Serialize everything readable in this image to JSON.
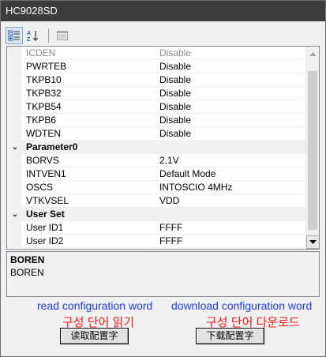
{
  "window": {
    "title": "HC9028SD"
  },
  "toolbar": {
    "buttons": [
      {
        "icon": "categorized-icon",
        "pressed": true
      },
      {
        "icon": "sort-alphabetical-icon",
        "pressed": false
      },
      {
        "icon": "property-pages-icon",
        "pressed": false
      }
    ]
  },
  "grid": {
    "rows": [
      {
        "kind": "prop",
        "name": "ICDEN",
        "value": "Disable",
        "muted": true
      },
      {
        "kind": "prop",
        "name": "PWRTEB",
        "value": "Disable"
      },
      {
        "kind": "prop",
        "name": "TKPB10",
        "value": "Disable"
      },
      {
        "kind": "prop",
        "name": "TKPB32",
        "value": "Disable"
      },
      {
        "kind": "prop",
        "name": "TKPB54",
        "value": "Disable"
      },
      {
        "kind": "prop",
        "name": "TKPB6",
        "value": "Disable"
      },
      {
        "kind": "prop",
        "name": "WDTEN",
        "value": "Disable"
      },
      {
        "kind": "category",
        "name": "Parameter0"
      },
      {
        "kind": "prop",
        "name": "BORVS",
        "value": "2,1V"
      },
      {
        "kind": "prop",
        "name": "INTVEN1",
        "value": "Default Mode"
      },
      {
        "kind": "prop",
        "name": "OSCS",
        "value": "INTOSCIO 4MHz"
      },
      {
        "kind": "prop",
        "name": "VTKVSEL",
        "value": "VDD"
      },
      {
        "kind": "category",
        "name": "User Set"
      },
      {
        "kind": "prop",
        "name": "User ID1",
        "value": "FFFF"
      },
      {
        "kind": "prop",
        "name": "User ID2",
        "value": "FFFF"
      }
    ],
    "collapse_glyph": "⌄"
  },
  "description": {
    "title": "BOREN",
    "text": "BOREN"
  },
  "annotations": {
    "read_en": "read configuration word",
    "read_ko": "구성 단어 읽기",
    "download_en": "download configuration word",
    "download_ko": "구성 단어 다운로드"
  },
  "buttons": {
    "read_label": "读取配置字",
    "download_label": "下载配置字"
  },
  "colors": {
    "annotation_blue": "#1e3cff",
    "annotation_red": "#ff1a1a",
    "titlebar": "#3c3c3c"
  }
}
